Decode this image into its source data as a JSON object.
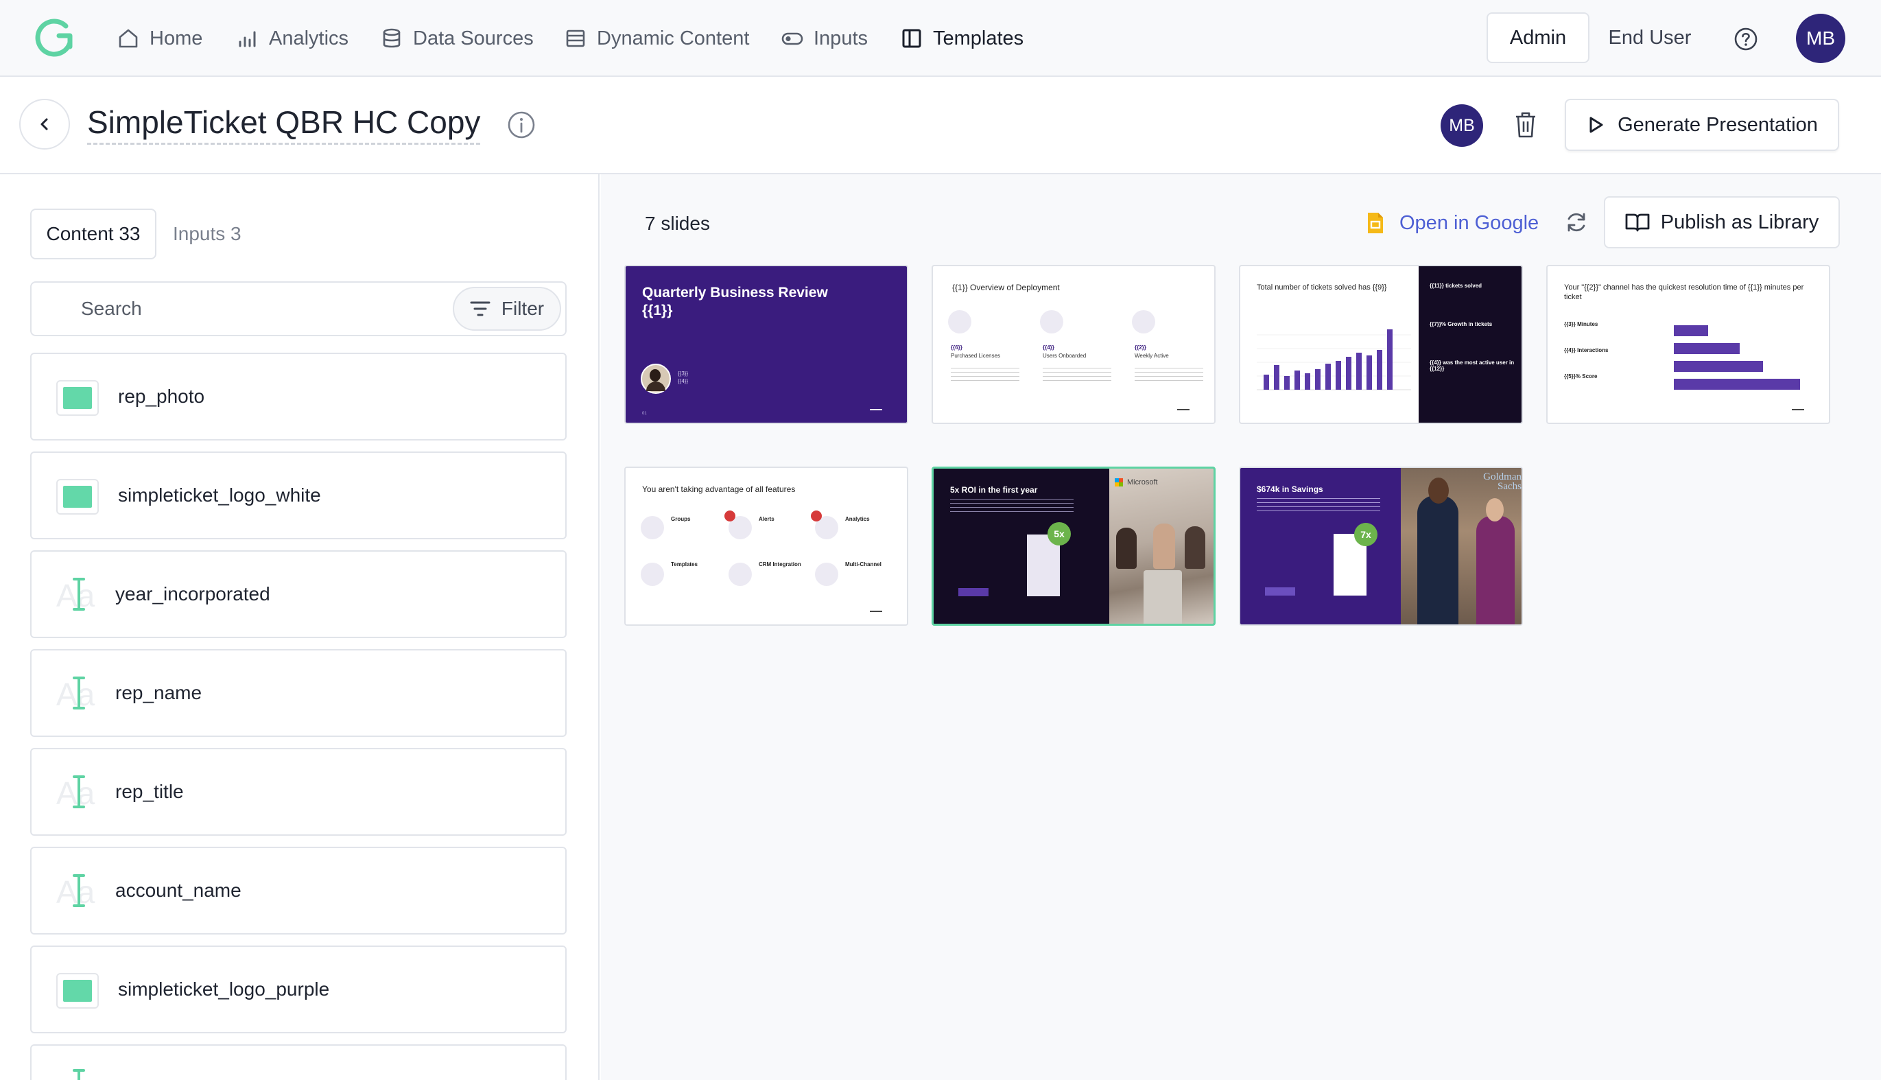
{
  "nav": {
    "items": [
      {
        "label": "Home",
        "icon": "home-icon"
      },
      {
        "label": "Analytics",
        "icon": "analytics-icon"
      },
      {
        "label": "Data Sources",
        "icon": "database-icon"
      },
      {
        "label": "Dynamic Content",
        "icon": "dynamic-content-icon"
      },
      {
        "label": "Inputs",
        "icon": "toggle-icon"
      },
      {
        "label": "Templates",
        "icon": "templates-icon"
      }
    ],
    "admin_label": "Admin",
    "end_user_label": "End User",
    "user_initials": "MB"
  },
  "header": {
    "title": "SimpleTicket QBR HC Copy",
    "collaborator_initials": "MB",
    "generate_label": "Generate Presentation"
  },
  "sidebar": {
    "tab_content": "Content 33",
    "tab_inputs": "Inputs 3",
    "search_placeholder": "Search",
    "filter_label": "Filter",
    "items": [
      {
        "label": "rep_photo",
        "type": "image"
      },
      {
        "label": "simpleticket_logo_white",
        "type": "image"
      },
      {
        "label": "year_incorporated",
        "type": "text"
      },
      {
        "label": "rep_name",
        "type": "text"
      },
      {
        "label": "rep_title",
        "type": "text"
      },
      {
        "label": "account_name",
        "type": "text"
      },
      {
        "label": "simpleticket_logo_purple",
        "type": "image"
      }
    ]
  },
  "main": {
    "slide_count": "7 slides",
    "open_google_label": "Open in Google",
    "publish_label": "Publish as Library"
  },
  "slides": {
    "s1": {
      "title": "Quarterly Business Review\n{{1}}",
      "line1": "{{3}}",
      "line2": "{{4}}",
      "num": "01"
    },
    "s2": {
      "title": "{{1}} Overview of Deployment",
      "c1v": "{{6}}",
      "c1l": "Purchased Licenses",
      "c2v": "{{4}}",
      "c2l": "Users Onboarded",
      "c3v": "{{2}}",
      "c3l": "Weekly Active"
    },
    "s3": {
      "title": "Total number of tickets solved has {{9}}",
      "r1": "{{11}} tickets solved",
      "r2": "{{7}}% Growth in tickets",
      "r3": "{{4}} was the most active user in {{12}}"
    },
    "s4": {
      "title": "Your \"{{2}}\" channel has the quickest resolution time of {{1}} minutes per ticket",
      "m1": "{{3}} Minutes",
      "m2": "{{4}} Interactions",
      "m3": "{{5}}% Score"
    },
    "s5": {
      "title": "You aren't taking advantage of all features",
      "f1": "Groups",
      "f2": "Alerts",
      "f3": "Analytics",
      "f4": "Templates",
      "f5": "CRM Integration",
      "f6": "Multi-Channel"
    },
    "s6": {
      "title": "5x ROI in the first year",
      "badge": "5x",
      "brand": "Microsoft"
    },
    "s7": {
      "title": "$674k in Savings",
      "badge": "7x",
      "brand": "Goldman Sachs"
    }
  }
}
